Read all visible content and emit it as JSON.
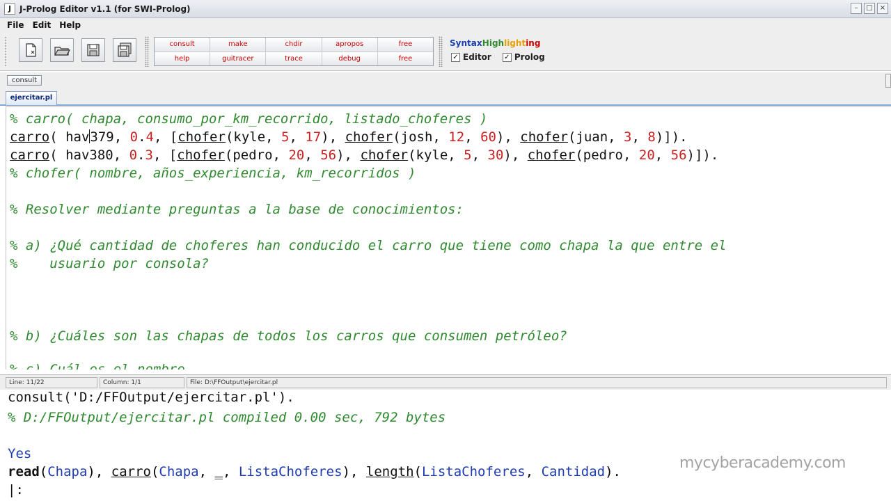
{
  "window": {
    "title": "J-Prolog Editor  v1.1  (for SWI-Prolog)",
    "app_icon": "J"
  },
  "menu": {
    "file": "File",
    "edit": "Edit",
    "help": "Help"
  },
  "toolbar": {
    "icons": [
      "new-file-icon",
      "open-folder-icon",
      "save-icon",
      "save-all-icon"
    ],
    "commands_row1": [
      "consult",
      "make",
      "chdir",
      "apropos",
      "free"
    ],
    "commands_row2": [
      "help",
      "guitracer",
      "trace",
      "debug",
      "free"
    ],
    "syntax_title_parts": [
      "Syntax",
      "High",
      "light",
      "ing"
    ],
    "syntax_title_colors": [
      "#1a3fb0",
      "#2f8a2f",
      "#e8a000",
      "#cc0000"
    ],
    "editor_label": "Editor",
    "prolog_label": "Prolog",
    "editor_checked": true,
    "prolog_checked": true
  },
  "consult_button": "consult",
  "tab": {
    "label": "ejercitar.pl"
  },
  "editor": {
    "lines": [
      "% carro( chapa, consumo_por_km_recorrido, listado_choferes )",
      "carro( hav379, 0.4, [chofer(kyle, 5, 17), chofer(josh, 12, 60), chofer(juan, 3, 8)]).",
      "carro( hav380, 0.3, [chofer(pedro, 20, 56), chofer(kyle, 5, 30), chofer(pedro, 20, 56)]).",
      "% chofer( nombre, años_experiencia, km_recorridos )",
      "% Resolver mediante preguntas a la base de conocimientos:",
      "% a) ¿Qué cantidad de choferes han conducido el carro que tiene como chapa la que entre el",
      "%    usuario por consola?",
      "% b) ¿Cuáles son las chapas de todos los carros que consumen petróleo?",
      "% c) Cuál es el nombre"
    ]
  },
  "status": {
    "line": "Line: 11/22",
    "column": "Column: 1/1",
    "file": "File: D:\\FFOutput\\ejercitar.pl"
  },
  "console": {
    "line1": "consult('D:/FFOutput/ejercitar.pl').",
    "line2": "% D:/FFOutput/ejercitar.pl compiled 0.00 sec, 792 bytes",
    "line3": "Yes",
    "line4": "read(Chapa), carro(Chapa, _, ListaChoferes), length(ListaChoferes, Cantidad).",
    "prompt": "|:"
  },
  "watermark": "mycyberacademy.com"
}
